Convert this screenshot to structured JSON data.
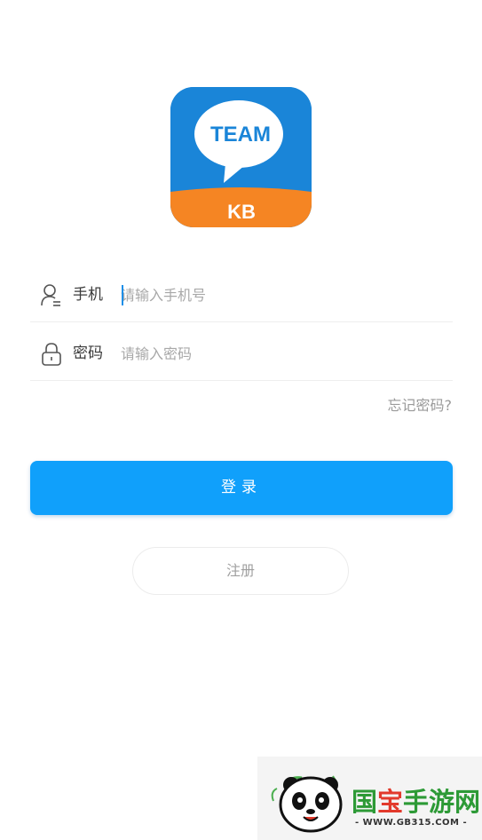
{
  "logo": {
    "text": "TEAM",
    "sub": "KB",
    "colors": {
      "bg": "#1a85d8",
      "bottom": "#f58523",
      "bubble": "#ffffff",
      "text": "#1a85d8"
    }
  },
  "form": {
    "phone": {
      "icon": "user-icon",
      "label": "手机",
      "placeholder": "请输入手机号",
      "value": ""
    },
    "password": {
      "icon": "lock-icon",
      "label": "密码",
      "placeholder": "请输入密码",
      "value": ""
    },
    "forgot": "忘记密码?"
  },
  "login_button": {
    "label": "登录",
    "color": "#10a0fb"
  },
  "register_button": {
    "label": "注册"
  },
  "watermark": {
    "brand_part1": "国",
    "brand_part2": "宝",
    "brand_part3": "手游网",
    "url": "- WWW.GB315.COM -"
  }
}
